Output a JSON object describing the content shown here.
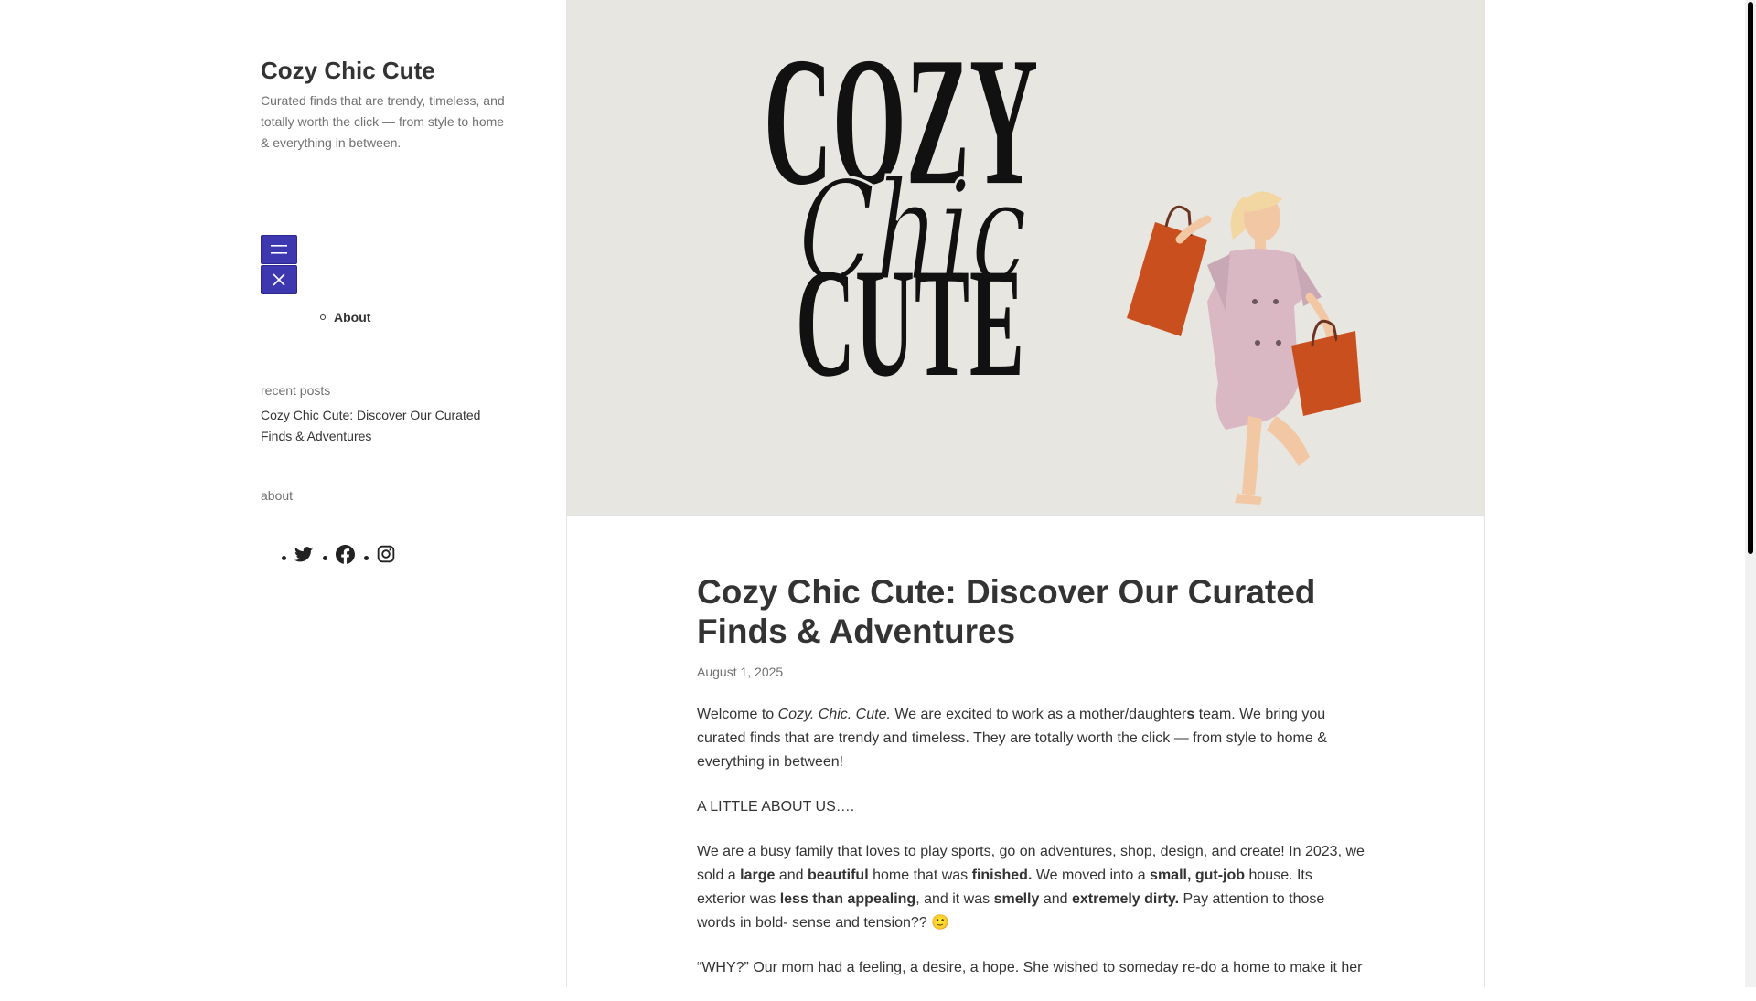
{
  "site": {
    "title": "Cozy Chic Cute",
    "description": "Curated finds that are trendy, timeless, and totally worth the click — from style to home & everything in between."
  },
  "menu": {
    "open_icon": "hamburger-icon",
    "close_icon": "close-icon",
    "items": [
      {
        "label": "About"
      }
    ]
  },
  "widgets": {
    "recent_title": "recent posts",
    "recent_posts": [
      {
        "label": "Cozy Chic Cute: Discover Our Curated Finds & Adventures"
      }
    ],
    "about_title": "about",
    "social": [
      "twitter-icon",
      "facebook-icon",
      "instagram-icon"
    ]
  },
  "hero": {
    "logo_lines": [
      "COZY",
      "Chic",
      "CUTE"
    ]
  },
  "post": {
    "title": "Cozy Chic Cute: Discover Our Curated Finds & Adventures",
    "date": "August 1, 2025",
    "p1": {
      "a": "Welcome to ",
      "b": "Cozy. Chic. Cute.",
      "c": " We are excited to work as a mother/daughter",
      "d": "s",
      "e": " team. We bring you curated finds that are trendy and timeless. They are totally worth the click — from style to home & everything in between!"
    },
    "p2": "A LITTLE ABOUT US….",
    "p3": {
      "a": "We are a busy family that loves to play sports, go on adventures, shop, design, and create! In 2023, we sold a ",
      "b": "large",
      "c": " and ",
      "d": "beautiful",
      "e": " home that was ",
      "f": "finished.",
      "g": " We moved into a ",
      "h": "small, gut-job",
      "i": " house. Its exterior was ",
      "j": "less than appealing",
      "k": ", and it was ",
      "l": "smelly",
      "m": " and ",
      "n": "extremely dirty.",
      "o": " Pay attention to those words in bold- sense and tension?? 🙂"
    },
    "p4": "“WHY?” Our mom had a feeling, a desire, a hope. She wished to someday re-do a home to make it her"
  },
  "colors": {
    "accent": "#3d37b0",
    "hero_bg": "#e8e6e0",
    "bag": "#c9501e",
    "dress": "#d9b8c4"
  }
}
